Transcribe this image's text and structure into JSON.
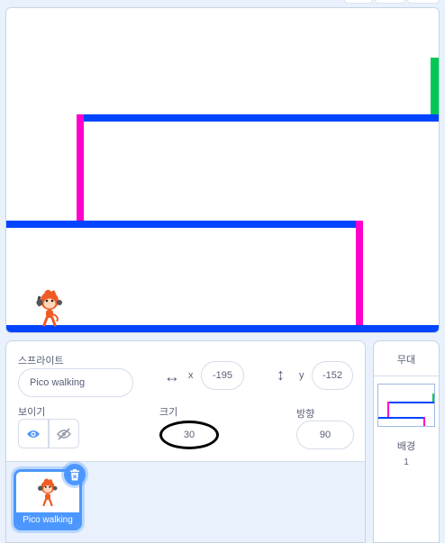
{
  "sprite_info": {
    "section_label": "스프라이트",
    "name_value": "Pico walking",
    "x_label": "x",
    "x_value": "-195",
    "y_label": "y",
    "y_value": "-152",
    "show_label": "보이기",
    "size_label": "크기",
    "size_value": "30",
    "direction_label": "방향",
    "direction_value": "90"
  },
  "sprite_list": [
    {
      "name": "Pico walking",
      "selected": true
    }
  ],
  "stage_panel": {
    "title": "무대",
    "backdrops_label": "배경",
    "backdrops_count": "1"
  },
  "colors": {
    "accent": "#4c97ff",
    "wall_blue": "#0044ff",
    "wall_magenta": "#ff00cc",
    "goal_green": "#00c853",
    "annotation": "#000000"
  }
}
